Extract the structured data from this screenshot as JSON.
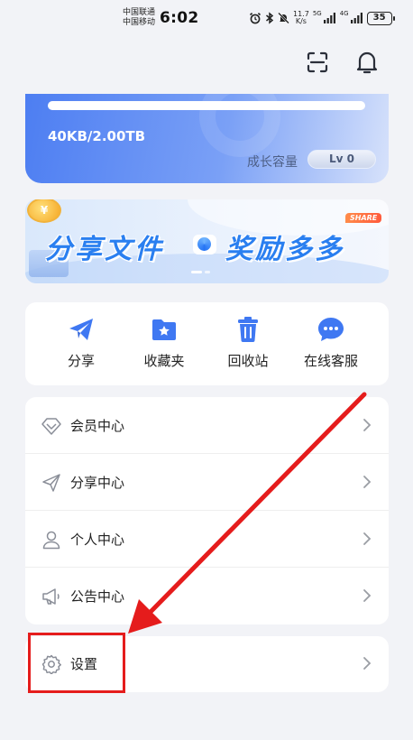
{
  "status_bar": {
    "carrier_1": "中国联通",
    "carrier_2": "中国移动",
    "time": "6:02",
    "net_speed_value": "11.7",
    "net_speed_unit": "K/s",
    "signal_1_label": "5G",
    "signal_2_label": "4G",
    "battery": "35"
  },
  "header": {
    "scan_icon": "scan-icon",
    "notification_icon": "bell-icon"
  },
  "storage": {
    "usage_text": "40KB/2.00TB",
    "usage_fraction": 0.0,
    "growth_label": "成长容量",
    "level": "Lv 0"
  },
  "banner": {
    "title_left": "分享文件",
    "title_right": "奖励多多",
    "tag": "SHARE",
    "coin_symbol": "¥"
  },
  "quick_actions": [
    {
      "label": "分享",
      "icon": "paper-plane-icon"
    },
    {
      "label": "收藏夹",
      "icon": "star-folder-icon"
    },
    {
      "label": "回收站",
      "icon": "trash-icon"
    },
    {
      "label": "在线客服",
      "icon": "chat-bubble-icon"
    }
  ],
  "menu": [
    {
      "label": "会员中心",
      "icon": "diamond-icon"
    },
    {
      "label": "分享中心",
      "icon": "send-icon"
    },
    {
      "label": "个人中心",
      "icon": "user-icon"
    },
    {
      "label": "公告中心",
      "icon": "megaphone-icon"
    }
  ],
  "settings": {
    "label": "设置",
    "icon": "gear-icon"
  },
  "colors": {
    "accent_blue": "#3a6ff0",
    "annotation_red": "#e51c1c",
    "background": "#f2f3f7"
  }
}
